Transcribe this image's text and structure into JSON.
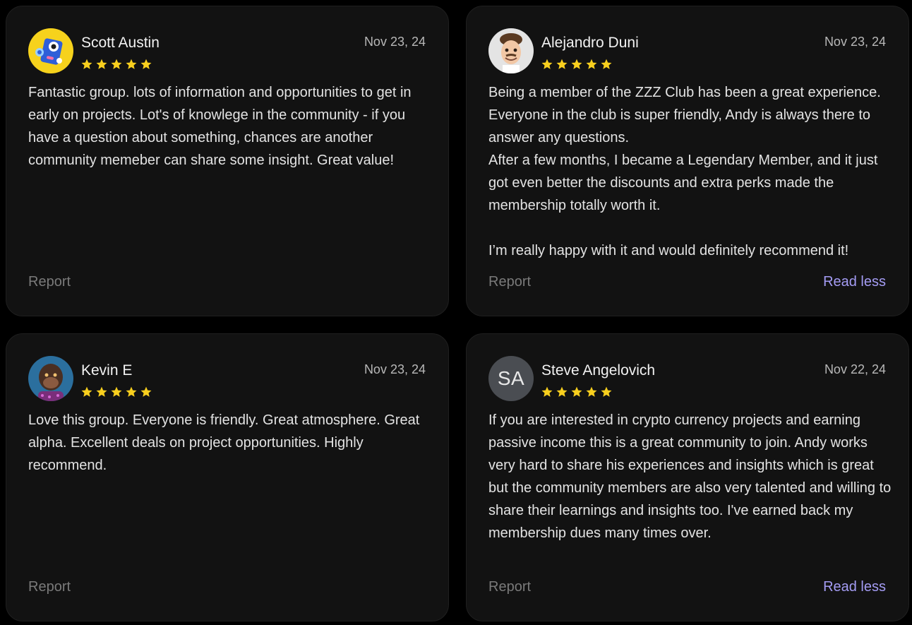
{
  "colors": {
    "background": "#000000",
    "card": "#121212",
    "star": "#f8cf1e",
    "link": "#a49cf4",
    "muted": "#7a7a7a"
  },
  "reviews": [
    {
      "name": "Scott Austin",
      "date": "Nov 23, 24",
      "rating": 5,
      "avatar": "robot-avatar",
      "text": "Fantastic group. lots of information and opportunities to get in early on projects. Lot's of knowlege in the community - if you have a question about something, chances are another community memeber can share some insight. Great value!",
      "report_label": "Report"
    },
    {
      "name": "Alejandro Duni",
      "date": "Nov 23, 24",
      "rating": 5,
      "avatar": "memoji-avatar",
      "text": "Being a member of the ZZZ Club has been a great experience. Everyone in the club is super friendly, Andy is always there to answer any questions.\nAfter a few months, I became a Legendary Member, and it just got even better the discounts and extra perks made the membership totally worth it.\n\nI’m really happy with it and would definitely recommend it!",
      "report_label": "Report",
      "read_less_label": "Read less"
    },
    {
      "name": "Kevin E",
      "date": "Nov 23, 24",
      "rating": 5,
      "avatar": "ape-avatar",
      "text": "Love this group. Everyone is friendly. Great atmosphere. Great alpha. Excellent deals on project opportunities. Highly recommend.",
      "report_label": "Report"
    },
    {
      "name": "Steve Angelovich",
      "date": "Nov 22, 24",
      "rating": 5,
      "initials": "SA",
      "text": "If you are interested in crypto currency projects and earning passive income this is a great community to join. Andy works very hard to share his experiences and insights which is great but the community members are also very talented and willing to share their learnings and insights too. I've earned back my membership dues many times over.",
      "report_label": "Report",
      "read_less_label": "Read less"
    }
  ]
}
